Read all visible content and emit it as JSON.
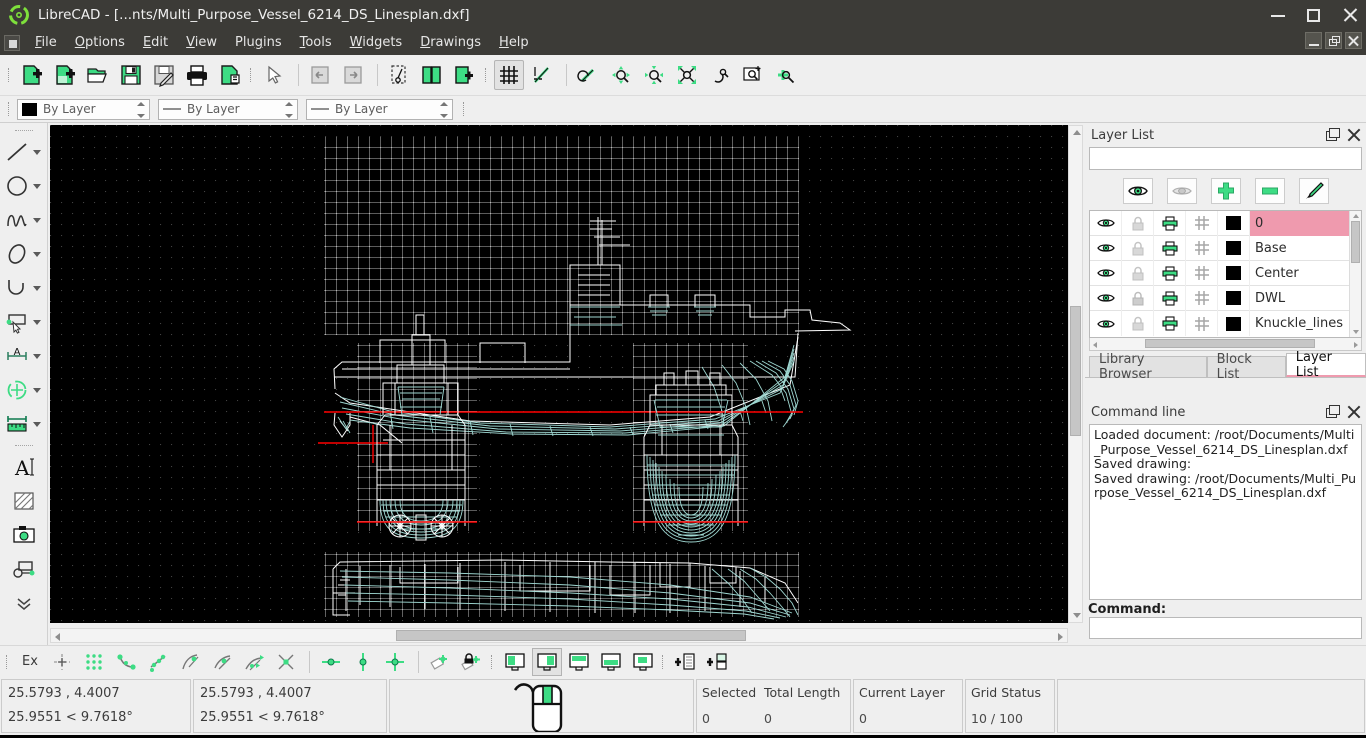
{
  "window": {
    "title": "LibreCAD - [...nts/Multi_Purpose_Vessel_6214_DS_Linesplan.dxf]",
    "logo_icon": "librecad-logo-icon",
    "minimize_label": "–",
    "maximize_label": "□",
    "close_label": "✕"
  },
  "menu": {
    "items": [
      {
        "label": "File",
        "mnemonic": "F"
      },
      {
        "label": "Options",
        "mnemonic": "O"
      },
      {
        "label": "Edit",
        "mnemonic": "E"
      },
      {
        "label": "View",
        "mnemonic": "V"
      },
      {
        "label": "Plugins",
        "mnemonic": "g"
      },
      {
        "label": "Tools",
        "mnemonic": "T"
      },
      {
        "label": "Widgets",
        "mnemonic": "W"
      },
      {
        "label": "Drawings",
        "mnemonic": "D"
      },
      {
        "label": "Help",
        "mnemonic": "H"
      }
    ],
    "document_icon": "document-menu-icon",
    "mdi": [
      "mdi-minimize",
      "mdi-restore",
      "mdi-close"
    ]
  },
  "toolbar": {
    "buttons": [
      {
        "name": "new-file-button",
        "icon": "new-document-icon",
        "tooltip": "New"
      },
      {
        "name": "new-from-template-button",
        "icon": "new-from-template-icon",
        "tooltip": "New from template"
      },
      {
        "name": "open-file-button",
        "icon": "open-folder-icon",
        "tooltip": "Open"
      },
      {
        "name": "save-button",
        "icon": "floppy-save-icon",
        "tooltip": "Save"
      },
      {
        "name": "save-as-button",
        "icon": "floppy-save-as-icon",
        "tooltip": "Save as"
      },
      {
        "name": "print-button",
        "icon": "printer-icon",
        "tooltip": "Print"
      },
      {
        "name": "print-preview-button",
        "icon": "print-preview-icon",
        "tooltip": "Print preview"
      },
      {
        "name": "select-pointer-button",
        "icon": "cursor-arrow-icon",
        "tooltip": "Select"
      },
      {
        "name": "undo-button",
        "icon": "undo-icon",
        "tooltip": "Undo"
      },
      {
        "name": "redo-button",
        "icon": "redo-icon",
        "tooltip": "Redo"
      },
      {
        "name": "cut-button",
        "icon": "scissors-cut-icon",
        "tooltip": "Cut"
      },
      {
        "name": "copy-button",
        "icon": "copy-pages-icon",
        "tooltip": "Copy"
      },
      {
        "name": "paste-button",
        "icon": "paste-icon",
        "tooltip": "Paste"
      },
      {
        "name": "toggle-grid-button",
        "icon": "grid-icon",
        "tooltip": "Grid",
        "active": true
      },
      {
        "name": "draw-order-button",
        "icon": "draw-order-icon",
        "tooltip": "Draw order"
      },
      {
        "name": "zoom-previous-button",
        "icon": "zoom-previous-icon",
        "tooltip": "Zoom previous"
      },
      {
        "name": "zoom-in-button",
        "icon": "zoom-in-icon",
        "tooltip": "Zoom in"
      },
      {
        "name": "zoom-out-button",
        "icon": "zoom-out-icon",
        "tooltip": "Zoom out"
      },
      {
        "name": "zoom-auto-button",
        "icon": "zoom-auto-icon",
        "tooltip": "Auto zoom"
      },
      {
        "name": "zoom-pan-button",
        "icon": "zoom-pan-icon",
        "tooltip": "Pan"
      },
      {
        "name": "zoom-window-button",
        "icon": "zoom-window-icon",
        "tooltip": "Zoom window"
      },
      {
        "name": "zoom-redraw-button",
        "icon": "zoom-redraw-icon",
        "tooltip": "Redraw"
      }
    ]
  },
  "attributes": {
    "color": {
      "label": "By Layer",
      "swatch": "#000000"
    },
    "linewidth": {
      "label": "By Layer"
    },
    "linetype": {
      "label": "By Layer"
    }
  },
  "tools": {
    "items": [
      {
        "name": "tool-line",
        "icon": "line-icon",
        "has_menu": true
      },
      {
        "name": "tool-circle",
        "icon": "circle-icon",
        "has_menu": true
      },
      {
        "name": "tool-spline",
        "icon": "spline-icon",
        "has_menu": true
      },
      {
        "name": "tool-ellipse",
        "icon": "ellipse-icon",
        "has_menu": true
      },
      {
        "name": "tool-arc",
        "icon": "arc-icon",
        "has_menu": true
      },
      {
        "name": "tool-select",
        "icon": "select-rect-icon",
        "has_menu": true
      },
      {
        "name": "tool-dimension",
        "icon": "dimension-icon",
        "has_menu": true
      },
      {
        "name": "tool-modify",
        "icon": "modify-move-icon",
        "has_menu": true
      },
      {
        "name": "tool-info-measure",
        "icon": "measure-ruler-icon",
        "has_menu": true
      },
      {
        "name": "tool-text",
        "icon": "text-a-icon",
        "has_menu": false
      },
      {
        "name": "tool-hatch",
        "icon": "hatch-icon",
        "has_menu": false
      },
      {
        "name": "tool-image",
        "icon": "image-icon",
        "has_menu": false
      },
      {
        "name": "tool-block",
        "icon": "block-icon",
        "has_menu": false
      },
      {
        "name": "tool-more",
        "icon": "chevron-double-down-icon",
        "has_menu": false
      }
    ]
  },
  "layer_panel": {
    "title": "Layer List",
    "float_icon": "float-window-icon",
    "close_icon": "close-icon",
    "filter_value": "",
    "filter_placeholder": "",
    "actions": [
      {
        "name": "show-all-layers-button",
        "icon": "eye-open-icon"
      },
      {
        "name": "hide-all-layers-button",
        "icon": "eye-closed-icon"
      },
      {
        "name": "add-layer-button",
        "icon": "plus-icon"
      },
      {
        "name": "remove-layer-button",
        "icon": "minus-icon"
      },
      {
        "name": "edit-layer-button",
        "icon": "edit-layer-icon"
      }
    ],
    "columns": [
      "visible",
      "locked",
      "print",
      "construction",
      "color",
      "name"
    ],
    "rows": [
      {
        "name": "0",
        "color": "#000000",
        "selected": true
      },
      {
        "name": "Base",
        "color": "#000000",
        "selected": false
      },
      {
        "name": "Center",
        "color": "#000000",
        "selected": false
      },
      {
        "name": "DWL",
        "color": "#000000",
        "selected": false
      },
      {
        "name": "Knuckle_lines",
        "color": "#000000",
        "selected": false
      }
    ],
    "tabs": [
      {
        "label": "Library Browser",
        "active": false
      },
      {
        "label": "Block List",
        "active": false
      },
      {
        "label": "Layer List",
        "active": true
      }
    ]
  },
  "command_panel": {
    "title": "Command line",
    "float_icon": "float-window-icon",
    "close_icon": "close-icon",
    "history": [
      "Loaded document: /root/Documents/Multi_Purpose_Vessel_6214_DS_Linesplan.dxf",
      "Saved drawing:",
      "Saved drawing: /root/Documents/Multi_Purpose_Vessel_6214_DS_Linesplan.dxf"
    ],
    "prompt_label": "Command:",
    "input_value": ""
  },
  "snapbar": {
    "ex_label": "Ex",
    "buttons": [
      {
        "name": "snap-free-button",
        "icon": "snap-free-icon"
      },
      {
        "name": "snap-grid-button",
        "icon": "snap-grid-icon"
      },
      {
        "name": "snap-endpoint-button",
        "icon": "snap-endpoint-icon"
      },
      {
        "name": "snap-onentity-button",
        "icon": "snap-on-entity-icon"
      },
      {
        "name": "snap-center-button",
        "icon": "snap-center-icon"
      },
      {
        "name": "snap-middle-button",
        "icon": "snap-middle-icon"
      },
      {
        "name": "snap-distance-button",
        "icon": "snap-distance-icon"
      },
      {
        "name": "snap-intersection-button",
        "icon": "snap-intersection-icon"
      },
      {
        "name": "restrict-horizontal-button",
        "icon": "restrict-horizontal-icon"
      },
      {
        "name": "restrict-vertical-button",
        "icon": "restrict-vertical-icon"
      },
      {
        "name": "restrict-orthogonal-button",
        "icon": "restrict-orthogonal-icon"
      },
      {
        "name": "relative-zero-button",
        "icon": "relative-zero-icon"
      },
      {
        "name": "lock-relative-zero-button",
        "icon": "lock-relative-zero-icon"
      },
      {
        "name": "view-fullscreen-button",
        "icon": "monitor-full-icon"
      },
      {
        "name": "view-statusbar-button",
        "icon": "monitor-status-icon",
        "active": true
      },
      {
        "name": "view-toolbar-button",
        "icon": "monitor-toolbar-icon"
      },
      {
        "name": "view-menu-button",
        "icon": "monitor-menu-icon"
      },
      {
        "name": "view-dock-button",
        "icon": "monitor-dock-icon"
      },
      {
        "name": "add-layer-quick-button",
        "icon": "add-list-icon"
      },
      {
        "name": "add-block-quick-button",
        "icon": "add-block-icon"
      }
    ]
  },
  "status": {
    "abs_coord": "25.5793 , 4.4007",
    "abs_polar": "25.9551 < 9.7618°",
    "rel_coord": "25.5793 , 4.4007",
    "rel_polar": "25.9551 < 9.7618°",
    "mouse_hint_icon": "mouse-widget-icon",
    "selected_label": "Selected",
    "selected_value": "0",
    "total_length_label": "Total Length",
    "total_length_value": "0",
    "current_layer_label": "Current Layer",
    "current_layer_value": "0",
    "grid_status_label": "Grid Status",
    "grid_status_value": "10 / 100"
  },
  "drawing": {
    "title": "Multi Purpose Vessel 6214 DS Linesplan",
    "background": "#000000",
    "grid_color": "#ffffff",
    "hull_color": "#9fd8d2",
    "outline_color": "#ffffff",
    "waterline_color": "#ff0000"
  }
}
